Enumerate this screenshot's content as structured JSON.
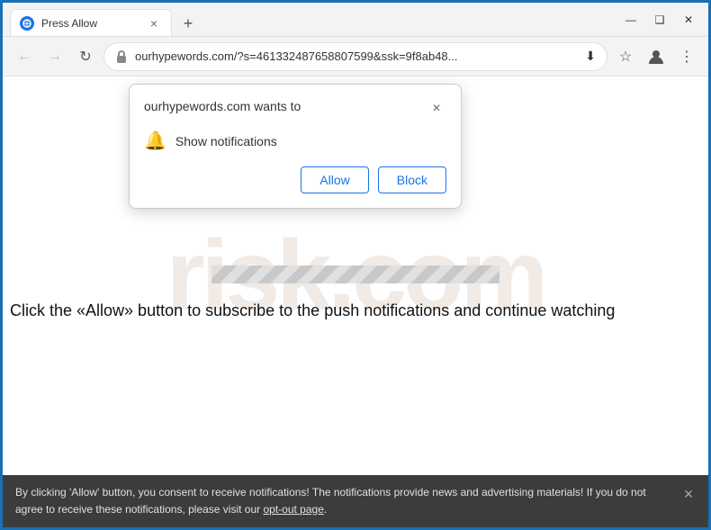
{
  "titlebar": {
    "tab_title": "Press Allow",
    "new_tab_btn": "+",
    "win_minimize": "—",
    "win_maximize": "❑",
    "win_close": "✕"
  },
  "omnibar": {
    "back": "←",
    "forward": "→",
    "refresh": "↻",
    "address": "ourhypewords.com/?s=461332487658807599&ssk=9f8ab48...",
    "address_domain": "ourhypewords.com",
    "address_rest": "/?s=461332487658807599&ssk=9f8ab48...",
    "star": "☆",
    "profile": "👤",
    "menu": "⋮"
  },
  "popup": {
    "title": "ourhypewords.com wants to",
    "close": "×",
    "permission_text": "Show notifications",
    "allow_label": "Allow",
    "block_label": "Block"
  },
  "content": {
    "cta_text": "Click the «Allow» button to subscribe to the push notifications and continue watching",
    "watermark": "risk.com"
  },
  "bottom_bar": {
    "text": "By clicking 'Allow' button, you consent to receive notifications! The notifications provide news and advertising materials! If you do not agree to receive these notifications, please visit our ",
    "link_text": "opt-out page",
    "text_after": ".",
    "close": "×"
  }
}
